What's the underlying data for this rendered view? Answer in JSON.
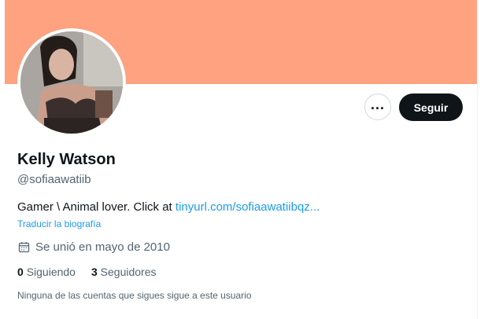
{
  "profile": {
    "name": "Kelly Watson",
    "handle": "@sofiaawatiib",
    "bio_text": "Gamer \\ Animal lover. Click at ",
    "bio_link": "tinyurl.com/sofiaawatiibqz...",
    "translate_label": "Traducir la biografía",
    "joined": "Se unió en mayo de 2010",
    "following_count": "0",
    "following_label": "Siguiendo",
    "followers_count": "3",
    "followers_label": "Seguidores",
    "mutual_note": "Ninguna de las cuentas que sigues sigue a este usuario"
  },
  "actions": {
    "more_icon": "more-horizontal-icon",
    "follow_label": "Seguir"
  },
  "colors": {
    "banner": "#ffa27f",
    "link": "#1d9bf0",
    "primary_text": "#0f1419",
    "secondary_text": "#536471",
    "follow_button": "#0f1419"
  }
}
